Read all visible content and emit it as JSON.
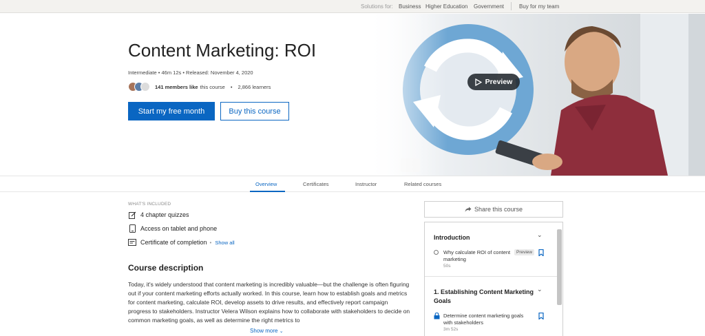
{
  "topbar": {
    "solutions_label": "Solutions for:",
    "links": [
      "Business",
      "Higher Education",
      "Government"
    ],
    "team_link": "Buy for my team"
  },
  "course": {
    "title": "Content Marketing: ROI",
    "meta": "Intermediate  •  46m 12s  •  Released: November 4, 2020",
    "members_count": "141 members like",
    "members_suffix": "this course",
    "learners": "2,866 learners",
    "primary_cta": "Start my free month",
    "secondary_cta": "Buy this course",
    "preview_label": "Preview"
  },
  "tabs": [
    {
      "label": "Overview",
      "active": true
    },
    {
      "label": "Certificates",
      "active": false
    },
    {
      "label": "Instructor",
      "active": false
    },
    {
      "label": "Related courses",
      "active": false
    }
  ],
  "included": {
    "heading": "WHAT'S INCLUDED",
    "items": [
      {
        "icon": "quiz-icon",
        "label": "4 chapter quizzes"
      },
      {
        "icon": "tablet-icon",
        "label": "Access on tablet and phone"
      },
      {
        "icon": "certificate-icon",
        "label": "Certificate of completion"
      }
    ],
    "show_all": "Show all"
  },
  "description": {
    "heading": "Course description",
    "text": "Today, it's widely understood that content marketing is incredibly valuable—but the challenge is often figuring out if your content marketing efforts actually worked. In this course, learn how to establish goals and metrics for content marketing, calculate ROI, develop assets to drive results, and effectively report campaign progress to stakeholders. Instructor Velera Wilson explains how to collaborate with stakeholders to decide on common marketing goals, as well as determine the right metrics to",
    "show_more": "Show more"
  },
  "sidebar": {
    "share_label": "Share this course",
    "sections": [
      {
        "title": "Introduction",
        "lessons": [
          {
            "title": "Why calculate ROI of content marketing",
            "duration": "50s",
            "badge": "Preview",
            "locked": false
          }
        ]
      },
      {
        "title": "1. Establishing Content Marketing Goals",
        "lessons": [
          {
            "title": "Determine content marketing goals with stakeholders",
            "duration": "3m 52s",
            "locked": true
          }
        ]
      }
    ]
  },
  "colors": {
    "accent": "#0a66c2",
    "hero_circle": "#6ea7d4"
  }
}
